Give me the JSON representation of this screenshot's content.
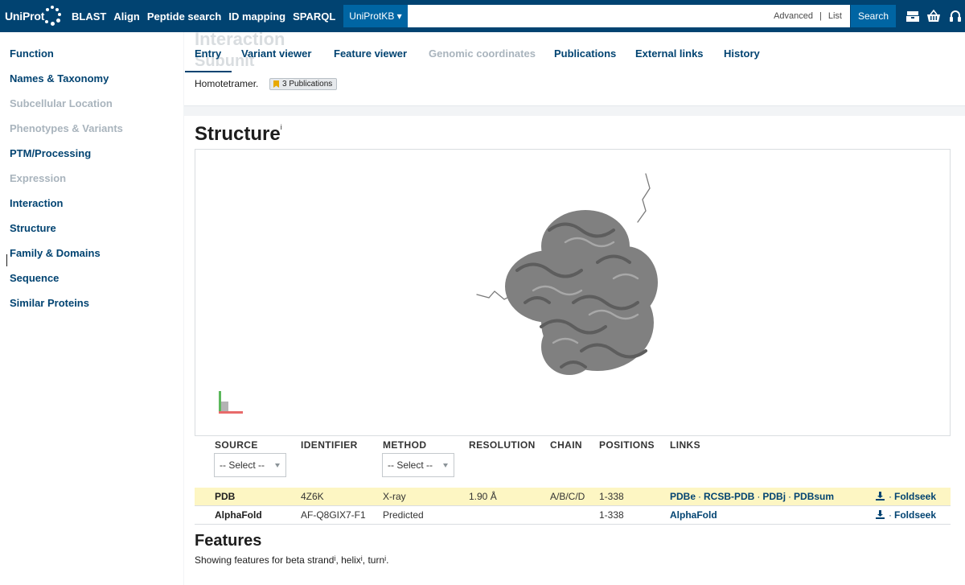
{
  "header": {
    "logo_text": "UniProt",
    "nav": [
      "BLAST",
      "Align",
      "Peptide search",
      "ID mapping",
      "SPARQL"
    ],
    "db_selector": "UniProtKB ▾",
    "search_placeholder": "",
    "advanced": "Advanced",
    "list": "List",
    "search_button": "Search",
    "colors": {
      "header_bg": "#014371",
      "accent": "#0065a3"
    }
  },
  "sidebar": {
    "items": [
      {
        "label": "Function",
        "enabled": true
      },
      {
        "label": "Names & Taxonomy",
        "enabled": true
      },
      {
        "label": "Subcellular Location",
        "enabled": false
      },
      {
        "label": "Phenotypes & Variants",
        "enabled": false
      },
      {
        "label": "PTM/Processing",
        "enabled": true
      },
      {
        "label": "Expression",
        "enabled": false
      },
      {
        "label": "Interaction",
        "enabled": true
      },
      {
        "label": "Structure",
        "enabled": true,
        "current": true
      },
      {
        "label": "Family & Domains",
        "enabled": true
      },
      {
        "label": "Sequence",
        "enabled": true
      },
      {
        "label": "Similar Proteins",
        "enabled": true
      }
    ]
  },
  "tabs": [
    {
      "label": "Entry",
      "active": true
    },
    {
      "label": "Variant viewer"
    },
    {
      "label": "Feature viewer"
    },
    {
      "label": "Genomic coordinates",
      "disabled": true
    },
    {
      "label": "Publications"
    },
    {
      "label": "External links"
    },
    {
      "label": "History"
    }
  ],
  "interaction": {
    "ghost_heading": "Interaction",
    "ghost_subheading": "Subunit",
    "subunit_text": "Homotetramer.",
    "publications_badge": "3 Publications"
  },
  "structure": {
    "title": "Structure",
    "info_mark": "i",
    "table": {
      "headers": [
        "SOURCE",
        "IDENTIFIER",
        "METHOD",
        "RESOLUTION",
        "CHAIN",
        "POSITIONS",
        "LINKS"
      ],
      "source_filter": "-- Select --",
      "method_filter": "-- Select --",
      "rows": [
        {
          "source": "PDB",
          "identifier": "4Z6K",
          "method": "X-ray",
          "resolution": "1.90 Å",
          "chain": "A/B/C/D",
          "positions": "1-338",
          "links": [
            "PDBe",
            "RCSB-PDB",
            "PDBj",
            "PDBsum"
          ],
          "extra": "Foldseek",
          "highlighted": true
        },
        {
          "source": "AlphaFold",
          "identifier": "AF-Q8GIX7-F1",
          "method": "Predicted",
          "resolution": "",
          "chain": "",
          "positions": "1-338",
          "links": [
            "AlphaFold"
          ],
          "extra": "Foldseek",
          "highlighted": false
        }
      ]
    }
  },
  "features": {
    "title": "Features",
    "text_prefix": "Showing features for beta strand",
    "text_mid1": ", helix",
    "text_mid2": ", turn",
    "text_suffix": ".",
    "info_mark": "i"
  }
}
